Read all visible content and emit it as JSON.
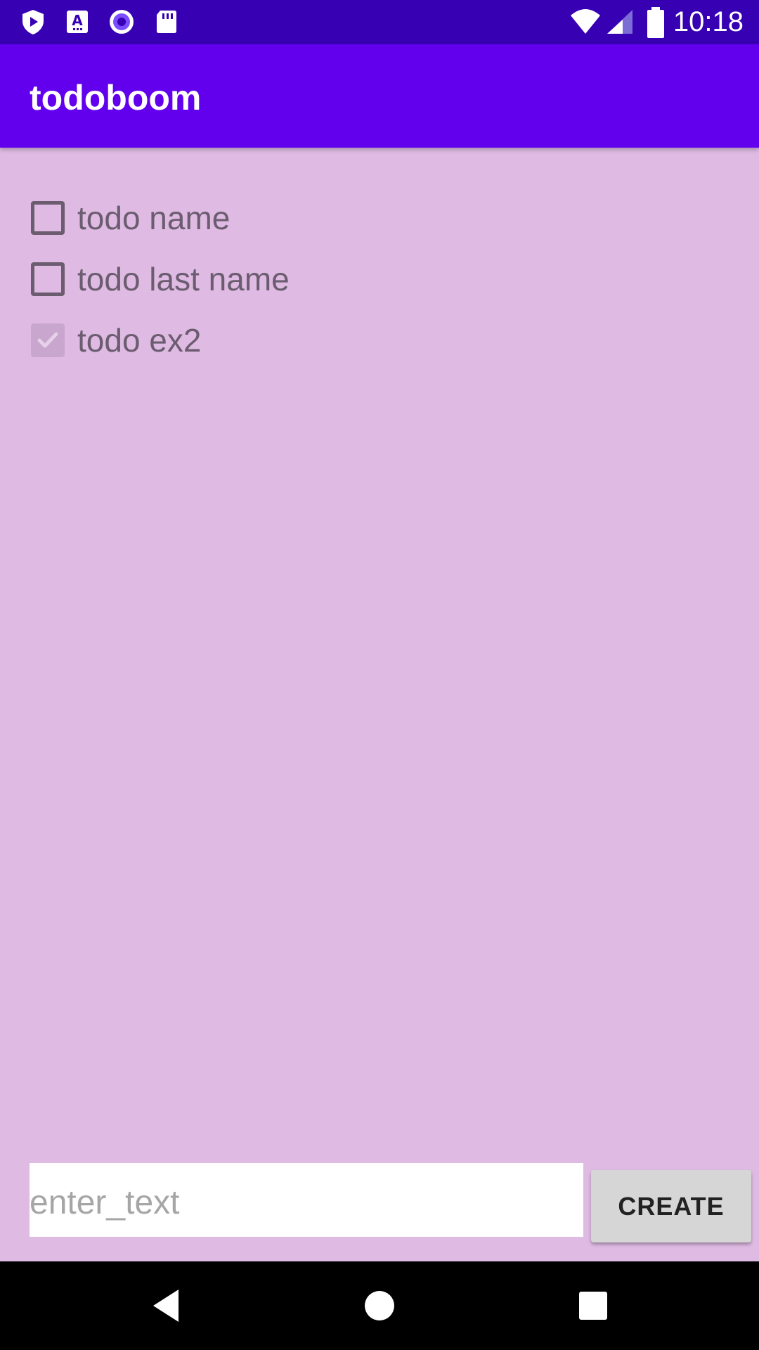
{
  "status_bar": {
    "time": "10:18",
    "icons": [
      "play-protect-icon",
      "font-a-icon",
      "circle-record-icon",
      "sd-card-icon",
      "wifi-icon",
      "signal-icon",
      "battery-icon"
    ],
    "color": "#3700b3"
  },
  "app_bar": {
    "title": "todoboom",
    "color": "#6200ee"
  },
  "todos": [
    {
      "label": "todo name",
      "checked": false
    },
    {
      "label": "todo last name",
      "checked": false
    },
    {
      "label": "todo ex2",
      "checked": true
    }
  ],
  "input": {
    "value": "",
    "placeholder": "enter_text"
  },
  "create_button": {
    "label": "CREATE"
  },
  "nav_bar": {
    "icons": [
      "back-icon",
      "home-icon",
      "recents-icon"
    ]
  },
  "colors": {
    "background": "#dfbbe3",
    "text": "#6b5c70"
  }
}
